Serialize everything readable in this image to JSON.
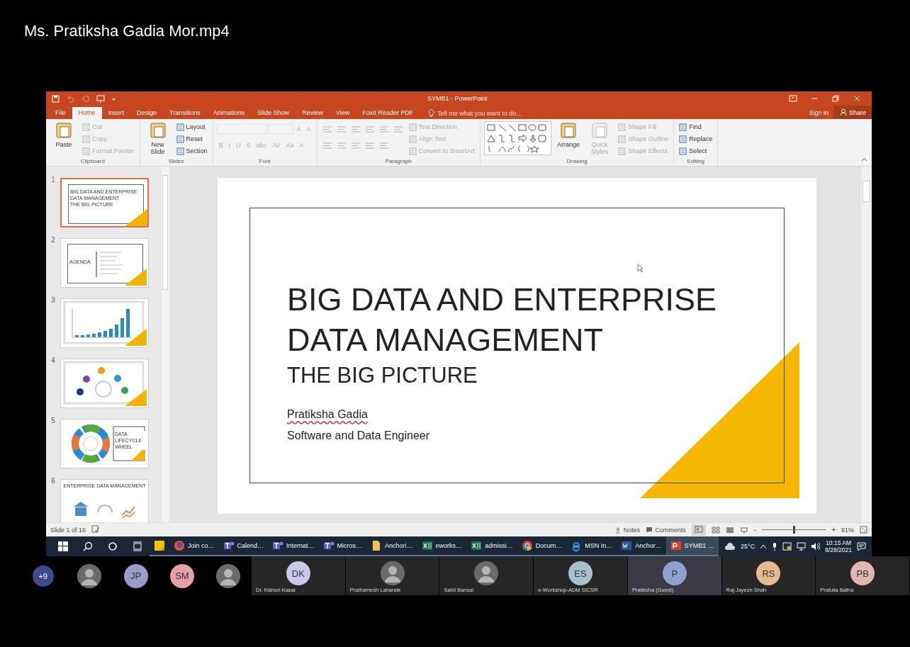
{
  "video_title": "Ms. Pratiksha Gadia Mor.mp4",
  "app": {
    "title": "SYMB1 - PowerPoint",
    "tabs": [
      {
        "label": "File",
        "selected": false
      },
      {
        "label": "Home",
        "selected": true
      },
      {
        "label": "Insert",
        "selected": false
      },
      {
        "label": "Design",
        "selected": false
      },
      {
        "label": "Transitions",
        "selected": false
      },
      {
        "label": "Animations",
        "selected": false
      },
      {
        "label": "Slide Show",
        "selected": false
      },
      {
        "label": "Review",
        "selected": false
      },
      {
        "label": "View",
        "selected": false
      },
      {
        "label": "Foxit Reader PDF",
        "selected": false
      }
    ],
    "tell_me": "Tell me what you want to do...",
    "sign_in": "Sign in",
    "share": "Share",
    "ribbon_groups": [
      {
        "name": "Clipboard",
        "columns": [
          [
            {
              "kind": "large",
              "label": "Paste",
              "disabled": false
            }
          ],
          [
            {
              "kind": "small",
              "label": "Cut",
              "disabled": true
            },
            {
              "kind": "small",
              "label": "Copy",
              "disabled": true
            },
            {
              "kind": "small",
              "label": "Format Painter",
              "disabled": true
            }
          ]
        ]
      },
      {
        "name": "Slides",
        "columns": [
          [
            {
              "kind": "large",
              "label": "New Slide",
              "disabled": false
            }
          ],
          [
            {
              "kind": "small",
              "label": "Layout",
              "disabled": false
            },
            {
              "kind": "small",
              "label": "Reset",
              "disabled": false
            },
            {
              "kind": "small",
              "label": "Section",
              "disabled": false
            }
          ]
        ]
      },
      {
        "name": "Font",
        "columns": [
          [
            {
              "kind": "font-fields",
              "labels": [
                "A",
                "A"
              ],
              "disabled": true
            },
            {
              "kind": "glyphs",
              "labels": [
                "B",
                "I",
                "U",
                "S",
                "abc",
                "AV",
                "Aa",
                "A"
              ],
              "disabled": true
            }
          ]
        ]
      },
      {
        "name": "Paragraph",
        "columns": [
          [
            {
              "kind": "list-icons",
              "disabled": true
            },
            {
              "kind": "align-icons",
              "disabled": true
            }
          ],
          [
            {
              "kind": "small",
              "label": "Text Direction",
              "disabled": true
            },
            {
              "kind": "small",
              "label": "Align Text",
              "disabled": true
            },
            {
              "kind": "small",
              "label": "Convert to SmartArt",
              "disabled": true
            }
          ]
        ]
      },
      {
        "name": "Drawing",
        "columns": [
          [
            {
              "kind": "gallery",
              "disabled": false
            }
          ],
          [
            {
              "kind": "large",
              "label": "Arrange",
              "disabled": false
            }
          ],
          [
            {
              "kind": "large",
              "label": "Quick Styles",
              "disabled": true
            }
          ],
          [
            {
              "kind": "small",
              "label": "Shape Fill",
              "disabled": true
            },
            {
              "kind": "small",
              "label": "Shape Outline",
              "disabled": true
            },
            {
              "kind": "small",
              "label": "Shape Effects",
              "disabled": true
            }
          ]
        ]
      },
      {
        "name": "Editing",
        "columns": [
          [
            {
              "kind": "small",
              "label": "Find",
              "disabled": false
            },
            {
              "kind": "small",
              "label": "Replace",
              "disabled": false
            },
            {
              "kind": "small",
              "label": "Select",
              "disabled": false
            }
          ]
        ]
      }
    ],
    "thumbnails": [
      {
        "number": "1",
        "selected": true,
        "kind": "title",
        "title": "BIG DATA AND ENTERPRISE DATA MANAGEMENT",
        "subtitle": "THE BIG PICTURE"
      },
      {
        "number": "2",
        "selected": false,
        "kind": "agenda",
        "title": "AGENDA"
      },
      {
        "number": "3",
        "selected": false,
        "kind": "chart"
      },
      {
        "number": "4",
        "selected": false,
        "kind": "diagram"
      },
      {
        "number": "5",
        "selected": false,
        "kind": "wheel",
        "title": "DATA LIFECYCLE WHEEL"
      },
      {
        "number": "6",
        "selected": false,
        "kind": "enterprise",
        "title": "ENTERPRISE DATA MANAGEMENT"
      }
    ],
    "slide": {
      "title": "BIG DATA AND ENTERPRISE DATA MANAGEMENT",
      "subtitle": "THE BIG PICTURE",
      "author": "Pratiksha Gadia",
      "role": "Software and Data Engineer"
    },
    "status_bar": {
      "slide_count": "Slide 1 of 16",
      "notes": "Notes",
      "comments": "Comments",
      "zoom_out": "-",
      "zoom_slider": {
        "level": 0.5
      },
      "zoom_in": "+",
      "zoom": "91%"
    }
  },
  "taskbar": {
    "apps": [
      {
        "kind": "sticky",
        "selected": false
      },
      {
        "kind": "firefox",
        "label": "Join co…",
        "selected": false
      },
      {
        "kind": "teams",
        "label": "Calend…",
        "selected": false
      },
      {
        "kind": "teams",
        "label": "Internat…",
        "selected": false
      },
      {
        "kind": "teams",
        "label": "Micros…",
        "selected": false
      },
      {
        "kind": "folder",
        "label": "Anchori…",
        "selected": false
      },
      {
        "kind": "excel",
        "label": "eworks…",
        "selected": false
      },
      {
        "kind": "excel",
        "label": "admissi…",
        "selected": false
      },
      {
        "kind": "chrome",
        "label": "Docum…",
        "selected": false
      },
      {
        "kind": "edge",
        "label": "MSN In…",
        "selected": false
      },
      {
        "kind": "word",
        "label": "Anchor…",
        "selected": false
      },
      {
        "kind": "powerpoint",
        "label": "SYMB1 …",
        "selected": true
      }
    ],
    "temperature": "25°C",
    "time": "10:15 AM",
    "date": "8/28/2021"
  },
  "participants": [
    {
      "kind": "count",
      "label": "+9",
      "color": "#3d4a8c"
    },
    {
      "kind": "photo"
    },
    {
      "kind": "initials",
      "label": "JP",
      "color": "#9a9ccc"
    },
    {
      "kind": "initials",
      "label": "SM",
      "color": "#e8a0a8"
    },
    {
      "kind": "photo"
    }
  ],
  "tiles": [
    {
      "kind": "initials",
      "label": "DK",
      "color": "#c8c9ec",
      "name": "Dr. Kishori Kasat",
      "selected": false
    },
    {
      "kind": "photo",
      "name": "Prathamesh Lahande",
      "selected": false
    },
    {
      "kind": "photo",
      "name": "Sahil Bansal",
      "selected": false
    },
    {
      "kind": "initials",
      "label": "ES",
      "color": "#a7c0d0",
      "name": "e-Workshop-ADM SICSR",
      "selected": false
    },
    {
      "kind": "initials",
      "label": "P",
      "color": "#8fa0cf",
      "name": "Pratiksha (Guest)",
      "selected": true
    },
    {
      "kind": "initials",
      "label": "RS",
      "color": "#e6b990",
      "name": "Raj Jayesh Shah",
      "selected": false
    },
    {
      "kind": "initials",
      "label": "PB",
      "color": "#e3b6b4",
      "name": "Prafulla Bafna",
      "selected": false
    }
  ]
}
